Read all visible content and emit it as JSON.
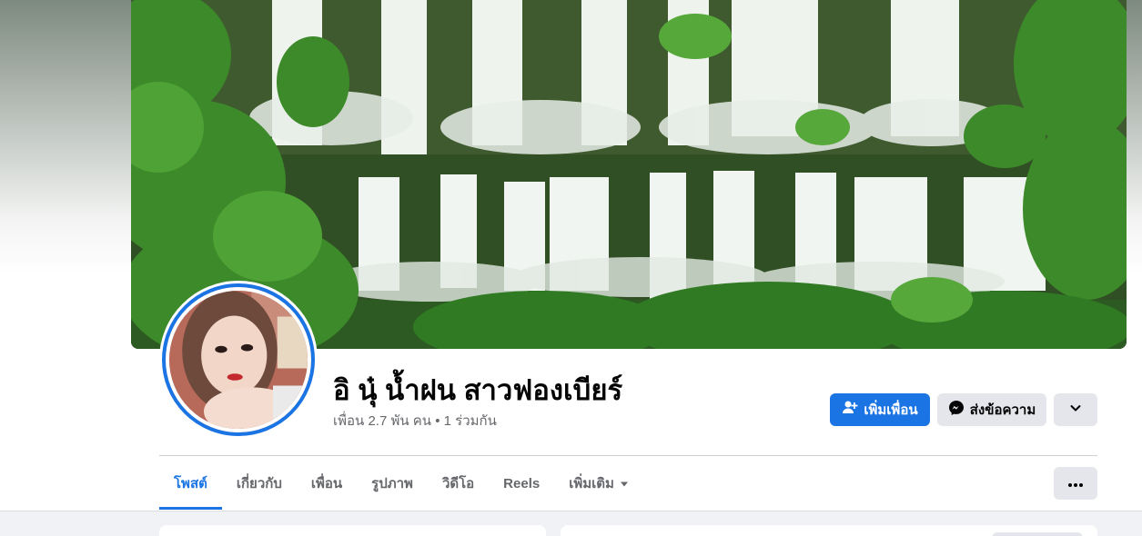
{
  "profile": {
    "name": "อิ นุ๋ น้ำฝน สาวฟองเบียร์",
    "friends_line": "เพื่อน 2.7 พัน คน • 1 ร่วมกัน"
  },
  "actions": {
    "add_friend_label": "เพิ่มเพื่อน",
    "message_label": "ส่งข้อความ"
  },
  "tabs": [
    {
      "label": "โพสต์",
      "active": true
    },
    {
      "label": "เกี่ยวกับ",
      "active": false
    },
    {
      "label": "เพื่อน",
      "active": false
    },
    {
      "label": "รูปภาพ",
      "active": false
    },
    {
      "label": "วิดีโอ",
      "active": false
    },
    {
      "label": "Reels",
      "active": false
    },
    {
      "label": "เพิ่มเติม",
      "active": false
    }
  ],
  "icons": {
    "add_friend": "person-add-icon",
    "message": "messenger-icon",
    "dropdown": "chevron-down-icon",
    "more_tab": "caret-down-icon",
    "options": "ellipsis-icon"
  },
  "colors": {
    "accent": "#1b74e4",
    "secondary_button": "#e4e6eb",
    "muted_text": "#65676b"
  }
}
